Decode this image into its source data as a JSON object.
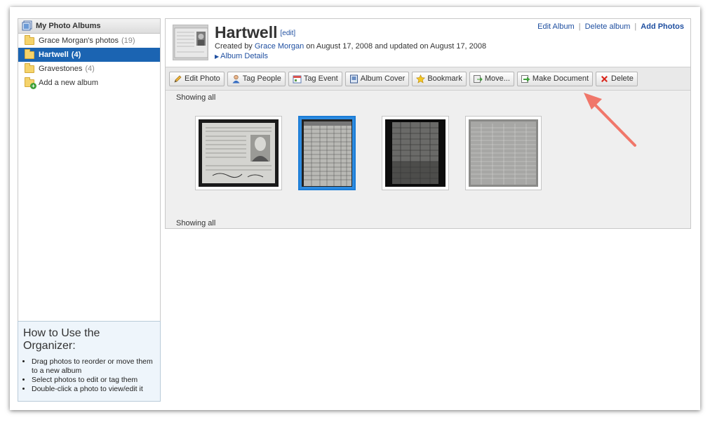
{
  "sidebar": {
    "title": "My Photo Albums",
    "albums": [
      {
        "label": "Grace Morgan's photos",
        "count": "(19)"
      },
      {
        "label": "Hartwell",
        "count": "(4)"
      },
      {
        "label": "Gravestones",
        "count": "(4)"
      }
    ],
    "add_label": "Add a new album"
  },
  "help": {
    "title": "How to Use the Organizer:",
    "items": [
      "Drag photos to reorder or move them to a new album",
      "Select photos to edit or tag them",
      "Double-click a photo to view/edit it"
    ]
  },
  "album": {
    "title": "Hartwell",
    "edit_label": "[edit]",
    "created_prefix": "Created by",
    "author": "Grace Morgan",
    "created_suffix": "on August 17, 2008 and updated on August 17, 2008",
    "details_label": "Album Details"
  },
  "top_links": {
    "edit_album": "Edit Album",
    "delete_album": "Delete album",
    "add_photos": "Add Photos",
    "separator": "|"
  },
  "toolbar": {
    "edit_photo": "Edit Photo",
    "tag_people": "Tag People",
    "tag_event": "Tag Event",
    "album_cover": "Album Cover",
    "bookmark": "Bookmark",
    "move": "Move...",
    "make_document": "Make Document",
    "delete": "Delete"
  },
  "grid": {
    "showing_top": "Showing all",
    "showing_bottom": "Showing all"
  },
  "colors": {
    "selected_blue": "#1b64b2",
    "link_blue": "#1f4fa0",
    "arrow": "#f0776a"
  }
}
